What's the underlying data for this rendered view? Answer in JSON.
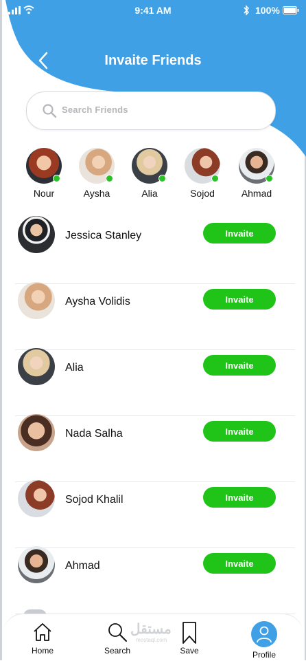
{
  "status_bar": {
    "time": "9:41 AM",
    "battery": "100%"
  },
  "header": {
    "title": "Invaite Friends"
  },
  "search": {
    "placeholder": "Search Friends"
  },
  "stories": [
    {
      "name": "Nour",
      "online": true
    },
    {
      "name": "Aysha",
      "online": true
    },
    {
      "name": "Alia",
      "online": true
    },
    {
      "name": "Sojod",
      "online": true
    },
    {
      "name": "Ahmad",
      "online": true
    }
  ],
  "friends": [
    {
      "name": "Jessica Stanley",
      "action": "Invaite"
    },
    {
      "name": "Aysha Volidis",
      "action": "Invaite"
    },
    {
      "name": "Alia",
      "action": "Invaite"
    },
    {
      "name": "Nada Salha",
      "action": "Invaite"
    },
    {
      "name": "Sojod Khalil",
      "action": "Invaite"
    },
    {
      "name": "Ahmad",
      "action": "Invaite"
    }
  ],
  "tabbar": {
    "items": [
      {
        "label": "Home",
        "icon": "home-icon"
      },
      {
        "label": "Search",
        "icon": "search-icon"
      },
      {
        "label": "Save",
        "icon": "bookmark-icon"
      },
      {
        "label": "Profile",
        "icon": "profile-icon",
        "active": true
      }
    ]
  },
  "watermark": {
    "text": "مستقل",
    "sub": "mostaql.com"
  },
  "colors": {
    "header_blue": "#3fa0e6",
    "invite_green": "#20c418",
    "online_dot": "#2bc227"
  }
}
